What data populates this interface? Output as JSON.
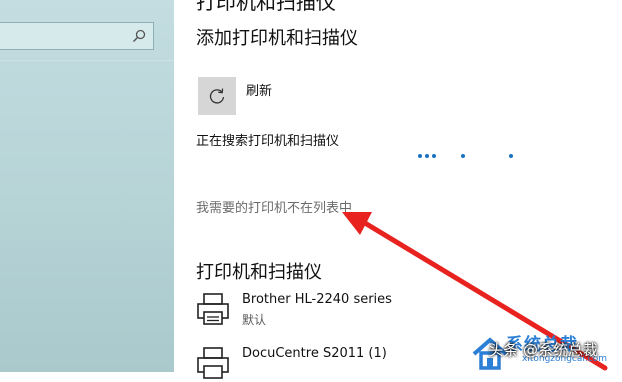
{
  "sidebar": {
    "search": {
      "placeholder": "",
      "icon": "search-icon"
    }
  },
  "header": {
    "partial_title": "打印机和扫描仪"
  },
  "add_section": {
    "title": "添加打印机和扫描仪",
    "refresh_label": "刷新",
    "searching_label": "正在搜索打印机和扫描仪",
    "not_listed_label": "我需要的打印机不在列表中"
  },
  "printers_section": {
    "title": "打印机和扫描仪",
    "items": [
      {
        "name": "Brother HL-2240 series",
        "status": "默认"
      },
      {
        "name": "DocuCentre S2011 (1)",
        "status": ""
      }
    ]
  },
  "watermark": {
    "brand": "系统总裁",
    "url": "xitongzongcai.com",
    "credit": "头条 @系统总裁"
  },
  "colors": {
    "accent": "#1a73c2",
    "annotation_arrow": "#e8231f",
    "sidebar_bg": "#b9d5d8"
  }
}
